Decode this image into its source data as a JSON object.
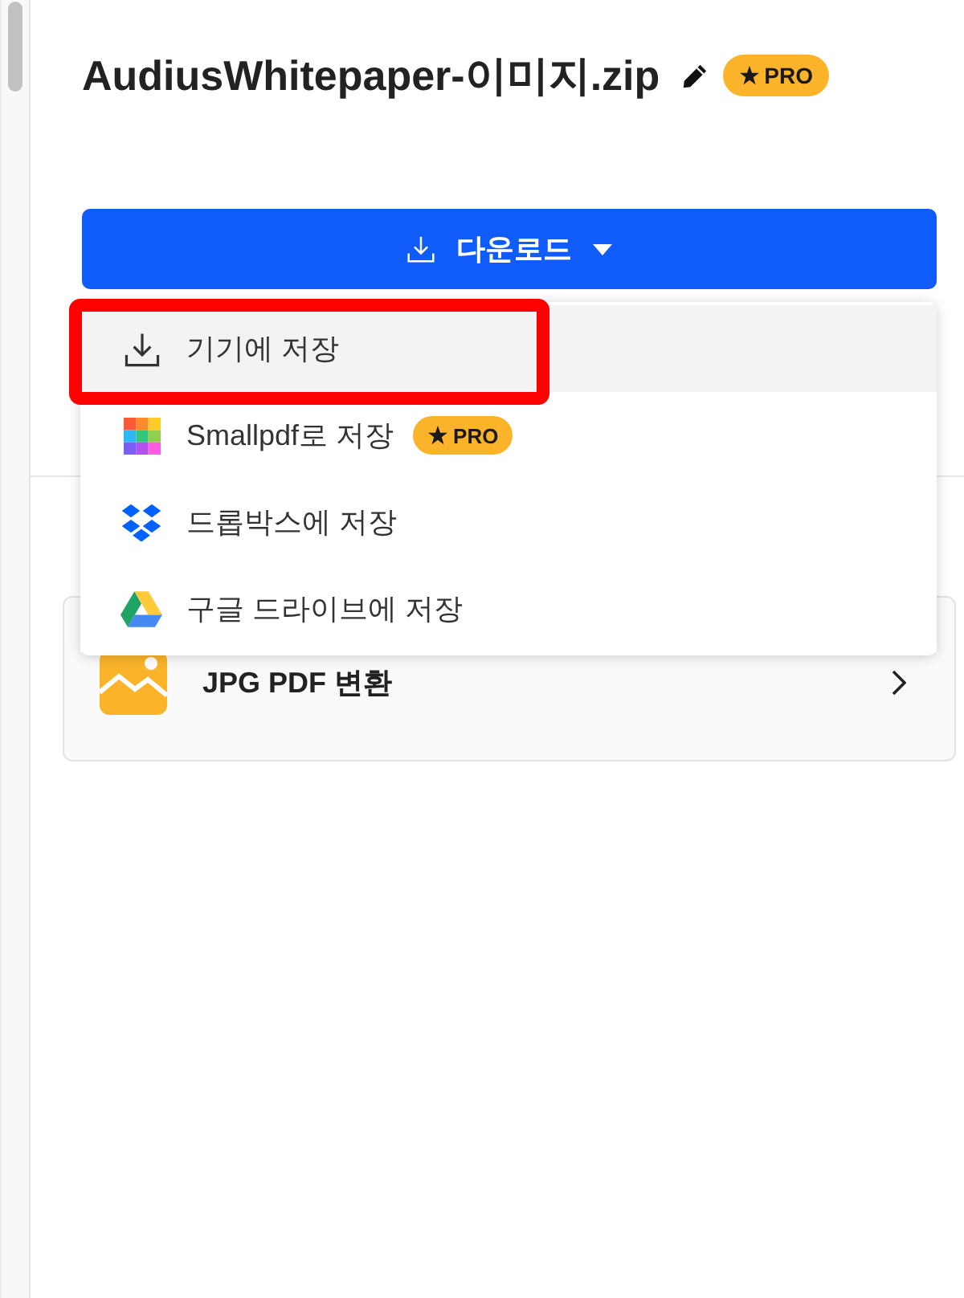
{
  "file": {
    "name": "AudiusWhitepaper-이미지.zip",
    "badge": "PRO"
  },
  "download_button": {
    "label": "다운로드",
    "expanded": true
  },
  "download_menu": [
    {
      "kind": "device",
      "label": "기기에 저장",
      "selected": true,
      "highlighted": true
    },
    {
      "kind": "smallpdf",
      "label": "Smallpdf로 저장",
      "badge": "PRO",
      "selected": false,
      "highlighted": false
    },
    {
      "kind": "dropbox",
      "label": "드롭박스에 저장",
      "selected": false,
      "highlighted": false
    },
    {
      "kind": "google_drive",
      "label": "구글 드라이브에 저장",
      "selected": false,
      "highlighted": false
    }
  ],
  "tools": [
    {
      "kind": "image",
      "label": "JPG PDF 변환"
    }
  ]
}
